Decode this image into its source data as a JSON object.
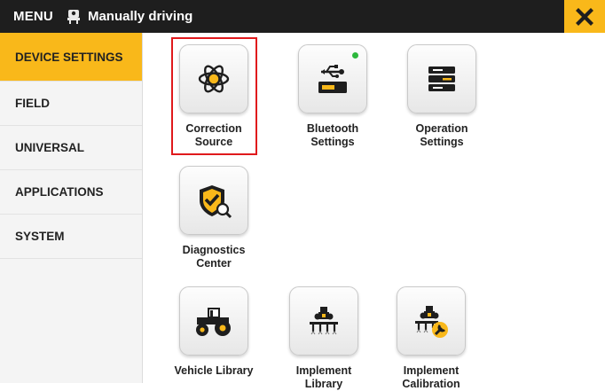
{
  "header": {
    "menu_label": "MENU",
    "status_label": "Manually driving",
    "accent_color": "#f9b81a"
  },
  "sidebar": {
    "items": [
      {
        "label": "DEVICE SETTINGS",
        "active": true
      },
      {
        "label": "FIELD",
        "active": false
      },
      {
        "label": "UNIVERSAL",
        "active": false
      },
      {
        "label": "APPLICATIONS",
        "active": false
      },
      {
        "label": "SYSTEM",
        "active": false
      }
    ]
  },
  "tiles": [
    {
      "label": "Correction\nSource",
      "icon": "atom-icon",
      "selected": true
    },
    {
      "label": "Bluetooth\nSettings",
      "icon": "usb-icon",
      "status": "connected"
    },
    {
      "label": "Operation\nSettings",
      "icon": "server-icon"
    },
    {
      "label": "Diagnostics\nCenter",
      "icon": "shield-check-icon"
    },
    {
      "label": "Vehicle Library",
      "icon": "tractor-icon"
    },
    {
      "label": "Implement\nLibrary",
      "icon": "implement-icon"
    },
    {
      "label": "Implement\nCalibration",
      "icon": "implement-wrench-icon"
    }
  ]
}
